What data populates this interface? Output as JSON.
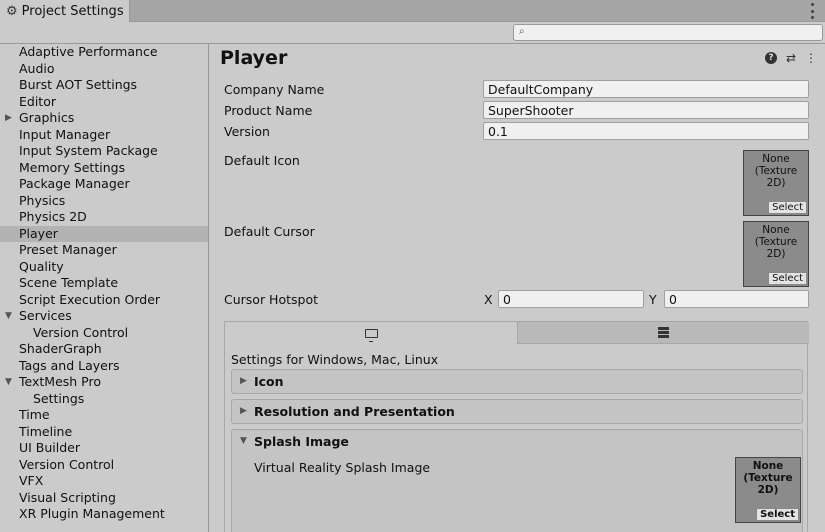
{
  "window": {
    "tab_title": "Project Settings",
    "tab_icon": "gear-icon",
    "search_placeholder": ""
  },
  "sidebar": {
    "items": [
      {
        "label": "Adaptive Performance",
        "level": 0
      },
      {
        "label": "Audio",
        "level": 0
      },
      {
        "label": "Burst AOT Settings",
        "level": 0
      },
      {
        "label": "Editor",
        "level": 0
      },
      {
        "label": "Graphics",
        "level": 0,
        "collapsed": true
      },
      {
        "label": "Input Manager",
        "level": 0
      },
      {
        "label": "Input System Package",
        "level": 0
      },
      {
        "label": "Memory Settings",
        "level": 0
      },
      {
        "label": "Package Manager",
        "level": 0
      },
      {
        "label": "Physics",
        "level": 0
      },
      {
        "label": "Physics 2D",
        "level": 0
      },
      {
        "label": "Player",
        "level": 0,
        "selected": true
      },
      {
        "label": "Preset Manager",
        "level": 0
      },
      {
        "label": "Quality",
        "level": 0
      },
      {
        "label": "Scene Template",
        "level": 0
      },
      {
        "label": "Script Execution Order",
        "level": 0
      },
      {
        "label": "Services",
        "level": 0,
        "expanded": true
      },
      {
        "label": "Version Control",
        "level": 1
      },
      {
        "label": "ShaderGraph",
        "level": 0
      },
      {
        "label": "Tags and Layers",
        "level": 0
      },
      {
        "label": "TextMesh Pro",
        "level": 0,
        "expanded": true
      },
      {
        "label": "Settings",
        "level": 1
      },
      {
        "label": "Time",
        "level": 0
      },
      {
        "label": "Timeline",
        "level": 0
      },
      {
        "label": "UI Builder",
        "level": 0
      },
      {
        "label": "Version Control",
        "level": 0
      },
      {
        "label": "VFX",
        "level": 0
      },
      {
        "label": "Visual Scripting",
        "level": 0
      },
      {
        "label": "XR Plugin Management",
        "level": 0
      }
    ]
  },
  "main": {
    "title": "Player",
    "company_name_label": "Company Name",
    "company_name_value": "DefaultCompany",
    "product_name_label": "Product Name",
    "product_name_value": "SuperShooter",
    "version_label": "Version",
    "version_value": "0.1",
    "default_icon_label": "Default Icon",
    "default_cursor_label": "Default Cursor",
    "texture_none_line1": "None",
    "texture_none_line2": "(Texture 2D)",
    "texture_select": "Select",
    "cursor_hotspot_label": "Cursor Hotspot",
    "hotspot_x_label": "X",
    "hotspot_x_value": "0",
    "hotspot_y_label": "Y",
    "hotspot_y_value": "0"
  },
  "platform": {
    "settings_for": "Settings for Windows, Mac, Linux",
    "sections": {
      "icon": "Icon",
      "resolution": "Resolution and Presentation",
      "splash": "Splash Image"
    },
    "vr_splash_label": "Virtual Reality Splash Image"
  },
  "colors": {
    "panel_bg": "#cbcbcb",
    "selected_bg": "#b3b3b3",
    "field_bg": "#f0f0f0"
  }
}
